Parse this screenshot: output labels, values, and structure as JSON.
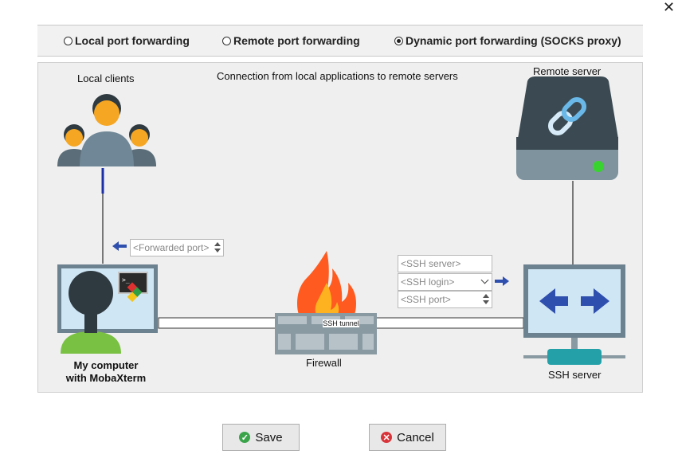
{
  "window": {
    "close_glyph": "✕"
  },
  "modes": [
    {
      "label": "Local port forwarding",
      "selected": false
    },
    {
      "label": "Remote port forwarding",
      "selected": false
    },
    {
      "label": "Dynamic port forwarding (SOCKS proxy)",
      "selected": true
    }
  ],
  "diagram": {
    "description": "Connection from local applications to remote servers",
    "local_clients_label": "Local clients",
    "remote_server_label": "Remote server",
    "my_computer_label_line1": "My computer",
    "my_computer_label_line2": "with MobaXterm",
    "firewall_label": "Firewall",
    "ssh_server_label": "SSH server",
    "tunnel_label": "SSH tunnel"
  },
  "fields": {
    "forwarded_port": "<Forwarded port>",
    "ssh_server": "<SSH server>",
    "ssh_login": "<SSH login>",
    "ssh_port": "<SSH port>"
  },
  "buttons": {
    "save": "Save",
    "cancel": "Cancel"
  },
  "colors": {
    "accent_blue": "#2f4fae",
    "save_green": "#3aa44a",
    "cancel_red": "#d9343a",
    "flame": "#ff5a1f"
  }
}
